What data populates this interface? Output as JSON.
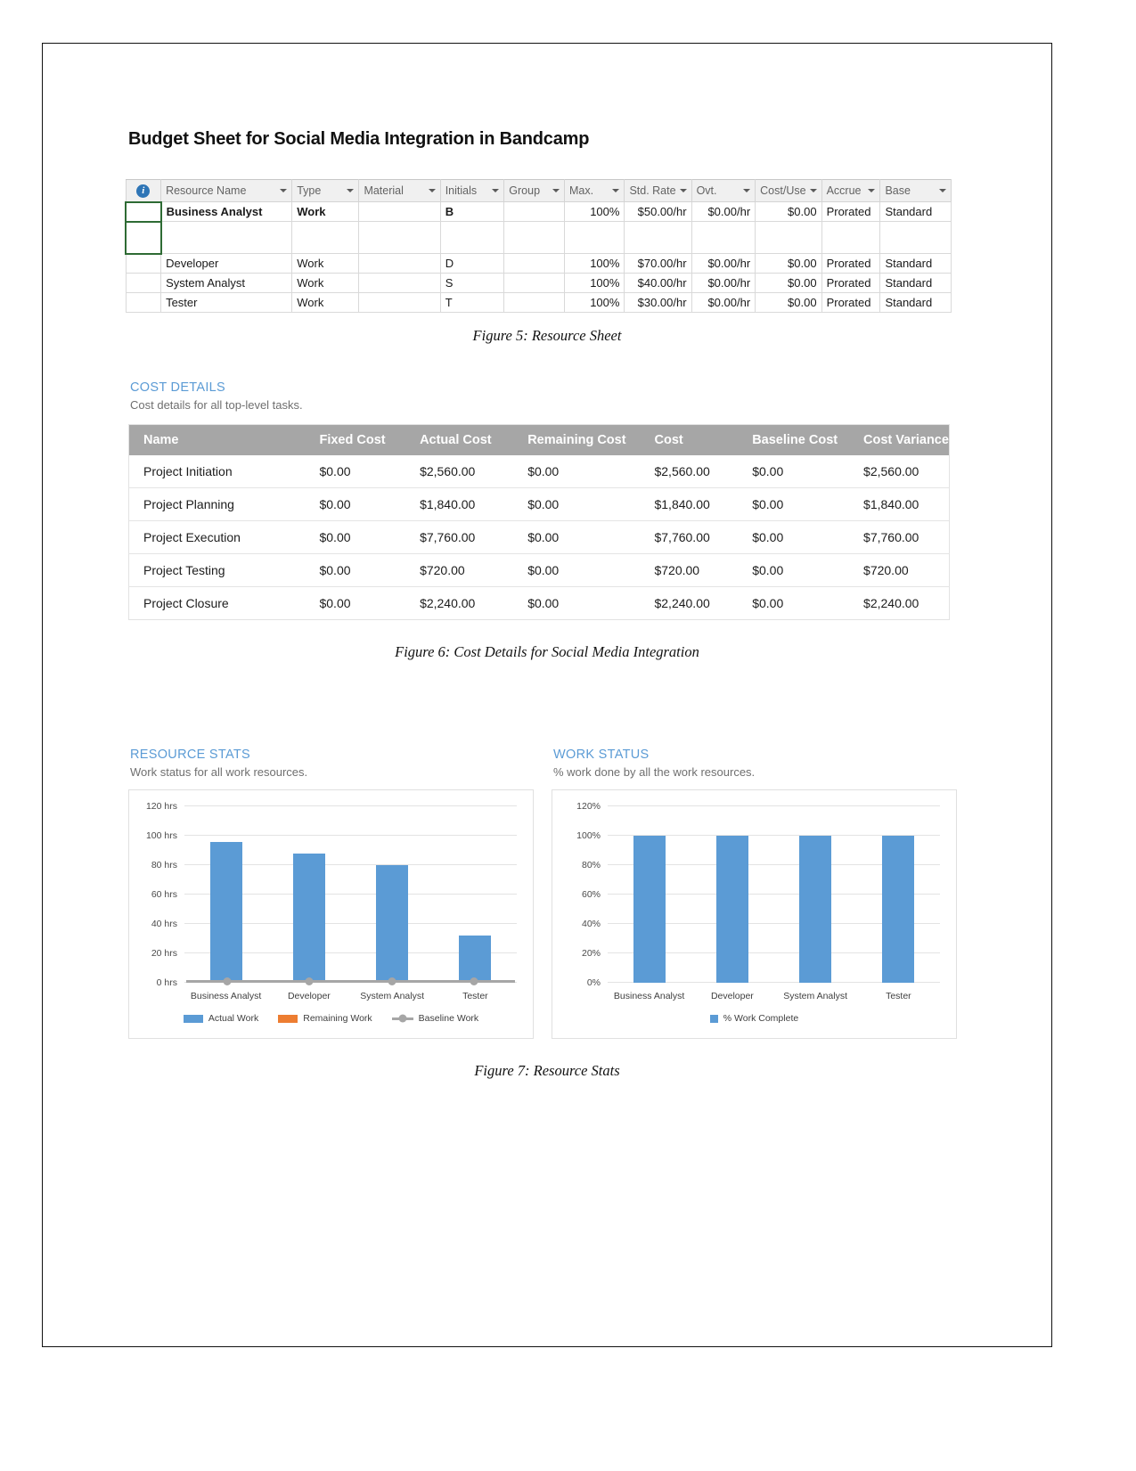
{
  "document": {
    "title": "Budget Sheet for Social Media Integration in Bandcamp"
  },
  "resource_sheet": {
    "info_icon": "info-icon",
    "columns": [
      {
        "label": "",
        "key": "info"
      },
      {
        "label": "Resource Name",
        "key": "resource_name"
      },
      {
        "label": "Type",
        "key": "type"
      },
      {
        "label": "Material",
        "key": "material"
      },
      {
        "label": "Initials",
        "key": "initials"
      },
      {
        "label": "Group",
        "key": "group"
      },
      {
        "label": "Max.",
        "key": "max"
      },
      {
        "label": "Std. Rate",
        "key": "std_rate"
      },
      {
        "label": "Ovt.",
        "key": "ovt"
      },
      {
        "label": "Cost/Use",
        "key": "cost_use"
      },
      {
        "label": "Accrue",
        "key": "accrue"
      },
      {
        "label": "Base",
        "key": "base"
      }
    ],
    "rows": [
      {
        "resource_name": "Business Analyst",
        "type": "Work",
        "material": "",
        "initials": "B",
        "group": "",
        "max": "100%",
        "std_rate": "$50.00/hr",
        "ovt": "$0.00/hr",
        "cost_use": "$0.00",
        "accrue": "Prorated",
        "base": "Standard"
      },
      {
        "resource_name": "Developer",
        "type": "Work",
        "material": "",
        "initials": "D",
        "group": "",
        "max": "100%",
        "std_rate": "$70.00/hr",
        "ovt": "$0.00/hr",
        "cost_use": "$0.00",
        "accrue": "Prorated",
        "base": "Standard"
      },
      {
        "resource_name": "System Analyst",
        "type": "Work",
        "material": "",
        "initials": "S",
        "group": "",
        "max": "100%",
        "std_rate": "$40.00/hr",
        "ovt": "$0.00/hr",
        "cost_use": "$0.00",
        "accrue": "Prorated",
        "base": "Standard"
      },
      {
        "resource_name": "Tester",
        "type": "Work",
        "material": "",
        "initials": "T",
        "group": "",
        "max": "100%",
        "std_rate": "$30.00/hr",
        "ovt": "$0.00/hr",
        "cost_use": "$0.00",
        "accrue": "Prorated",
        "base": "Standard"
      }
    ]
  },
  "figure5_caption": "Figure 5: Resource Sheet",
  "cost_details": {
    "heading": "COST DETAILS",
    "subheading": "Cost details for all top-level tasks.",
    "columns": [
      "Name",
      "Fixed Cost",
      "Actual Cost",
      "Remaining Cost",
      "Cost",
      "Baseline Cost",
      "Cost Variance"
    ],
    "rows": [
      {
        "name": "Project Initiation",
        "fixed_cost": "$0.00",
        "actual_cost": "$2,560.00",
        "remaining_cost": "$0.00",
        "cost": "$2,560.00",
        "baseline_cost": "$0.00",
        "cost_variance": "$2,560.00"
      },
      {
        "name": "Project Planning",
        "fixed_cost": "$0.00",
        "actual_cost": "$1,840.00",
        "remaining_cost": "$0.00",
        "cost": "$1,840.00",
        "baseline_cost": "$0.00",
        "cost_variance": "$1,840.00"
      },
      {
        "name": "Project Execution",
        "fixed_cost": "$0.00",
        "actual_cost": "$7,760.00",
        "remaining_cost": "$0.00",
        "cost": "$7,760.00",
        "baseline_cost": "$0.00",
        "cost_variance": "$7,760.00"
      },
      {
        "name": "Project Testing",
        "fixed_cost": "$0.00",
        "actual_cost": "$720.00",
        "remaining_cost": "$0.00",
        "cost": "$720.00",
        "baseline_cost": "$0.00",
        "cost_variance": "$720.00"
      },
      {
        "name": "Project Closure",
        "fixed_cost": "$0.00",
        "actual_cost": "$2,240.00",
        "remaining_cost": "$0.00",
        "cost": "$2,240.00",
        "baseline_cost": "$0.00",
        "cost_variance": "$2,240.00"
      }
    ]
  },
  "figure6_caption": "Figure 6: Cost Details for Social Media Integration",
  "figure7_caption": "Figure 7: Resource Stats",
  "colors": {
    "accent_blue": "#5b9bd5",
    "bar_blue": "#5b9bd5",
    "baseline_gray": "#a6a6a6",
    "remaining_orange": "#ed7d31",
    "header_gray": "#a6a6a6"
  },
  "chart_data": [
    {
      "type": "bar",
      "id": "resource-stats",
      "title": "RESOURCE STATS",
      "subtitle": "Work status for all work resources.",
      "categories": [
        "Business Analyst",
        "Developer",
        "System Analyst",
        "Tester"
      ],
      "series": [
        {
          "name": "Actual Work",
          "values": [
            96,
            88,
            80,
            32
          ],
          "color": "#5b9bd5",
          "kind": "bar"
        },
        {
          "name": "Remaining Work",
          "values": [
            0,
            0,
            0,
            0
          ],
          "color": "#ed7d31",
          "kind": "bar"
        },
        {
          "name": "Baseline Work",
          "values": [
            0,
            0,
            0,
            0
          ],
          "color": "#a6a6a6",
          "kind": "line"
        }
      ],
      "xlabel": "",
      "ylabel": "",
      "ylim": [
        0,
        120
      ],
      "yticks": [
        0,
        20,
        40,
        60,
        80,
        100,
        120
      ],
      "ytick_labels": [
        "0 hrs",
        "20 hrs",
        "40 hrs",
        "60 hrs",
        "80 hrs",
        "100 hrs",
        "120 hrs"
      ],
      "grid": true,
      "legend_position": "bottom"
    },
    {
      "type": "bar",
      "id": "work-status",
      "title": "WORK STATUS",
      "subtitle": "% work done by all the work resources.",
      "categories": [
        "Business Analyst",
        "Developer",
        "System Analyst",
        "Tester"
      ],
      "series": [
        {
          "name": "% Work Complete",
          "values": [
            100,
            100,
            100,
            100
          ],
          "color": "#5b9bd5",
          "kind": "bar"
        }
      ],
      "xlabel": "",
      "ylabel": "",
      "ylim": [
        0,
        120
      ],
      "yticks": [
        0,
        20,
        40,
        60,
        80,
        100,
        120
      ],
      "ytick_labels": [
        "0%",
        "20%",
        "40%",
        "60%",
        "80%",
        "100%",
        "120%"
      ],
      "grid": true,
      "legend_position": "bottom"
    }
  ]
}
